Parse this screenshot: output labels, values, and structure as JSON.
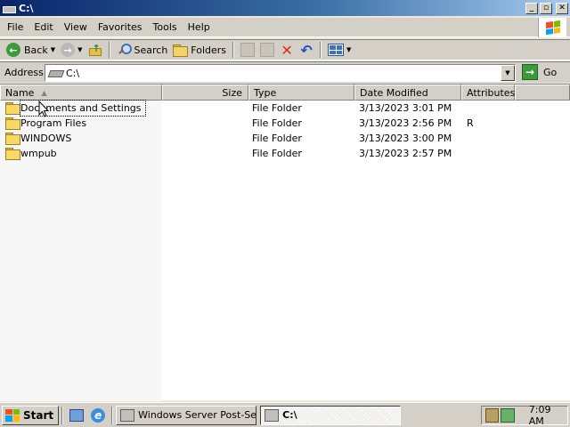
{
  "window": {
    "title": "C:\\"
  },
  "menu": {
    "items": [
      "File",
      "Edit",
      "View",
      "Favorites",
      "Tools",
      "Help"
    ]
  },
  "toolbar": {
    "back_label": "Back",
    "search_label": "Search",
    "folders_label": "Folders"
  },
  "address": {
    "label": "Address",
    "value": "C:\\",
    "go_label": "Go"
  },
  "columns": {
    "name": "Name",
    "size": "Size",
    "type": "Type",
    "date": "Date Modified",
    "attributes": "Attributes"
  },
  "files": [
    {
      "name": "Documents and Settings",
      "size": "",
      "type": "File Folder",
      "date": "3/13/2023 3:01 PM",
      "attributes": ""
    },
    {
      "name": "Program Files",
      "size": "",
      "type": "File Folder",
      "date": "3/13/2023 2:56 PM",
      "attributes": "R"
    },
    {
      "name": "WINDOWS",
      "size": "",
      "type": "File Folder",
      "date": "3/13/2023 3:00 PM",
      "attributes": ""
    },
    {
      "name": "wmpub",
      "size": "",
      "type": "File Folder",
      "date": "3/13/2023 2:57 PM",
      "attributes": ""
    }
  ],
  "taskbar": {
    "start_label": "Start",
    "tasks": [
      {
        "label": "Windows Server Post-Se..."
      },
      {
        "label": "C:\\"
      }
    ],
    "clock": "7:09 AM"
  }
}
